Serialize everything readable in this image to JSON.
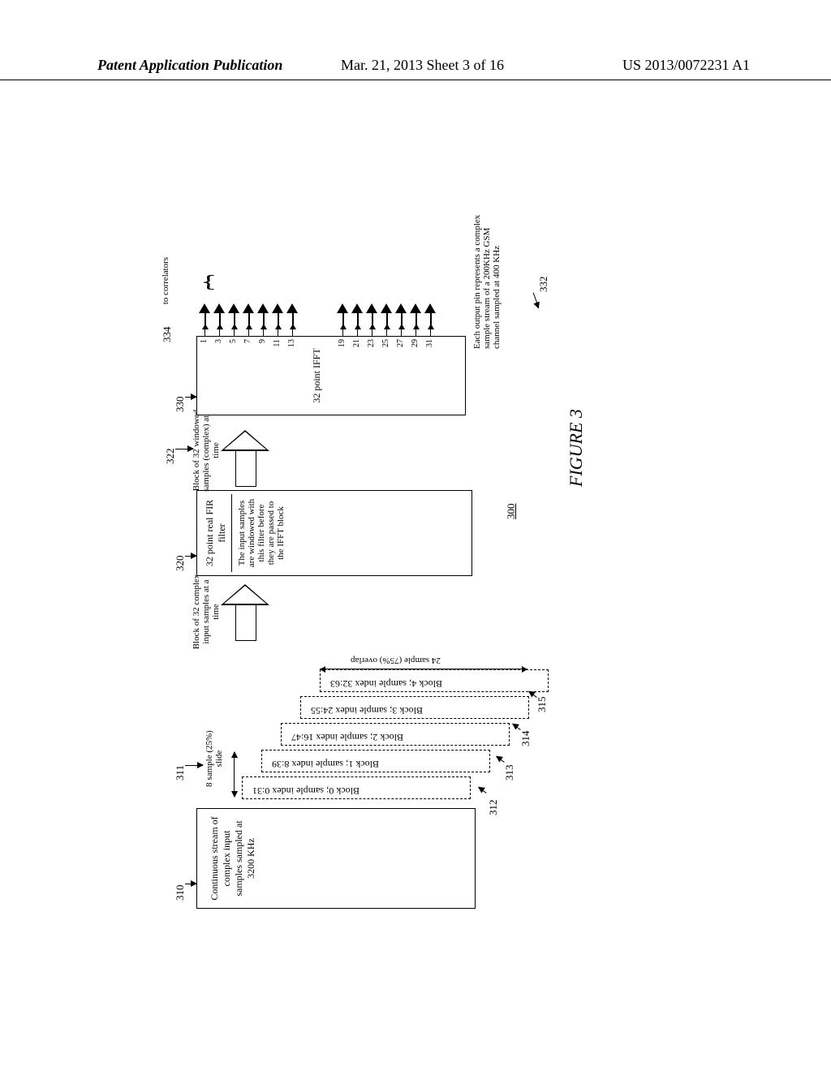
{
  "header": {
    "left": "Patent Application Publication",
    "center": "Mar. 21, 2013  Sheet 3 of 16",
    "right": "US 2013/0072231 A1"
  },
  "input_box": {
    "text": "Continuous stream of complex input samples sampled at 3200 KHz",
    "ref": "310"
  },
  "slide": {
    "text": "8 sample (25%) slide",
    "ref": "311"
  },
  "blocks": {
    "b0": "Block 0; sample index 0:31",
    "b1": "Block 1; sample index 8:39",
    "b2": "Block 2; sample index 16:47",
    "b3": "Block 3; sample index 24:55",
    "b4": "Block 4; sample index 32:63",
    "r0": "312",
    "r1": "313",
    "r2": "314",
    "r3": "315"
  },
  "overlap": "24 sample (75%) overlap",
  "arrow1": {
    "text": "Block of 32 complex input samples at a time"
  },
  "fir": {
    "title": "32 point real FIR filter",
    "desc": "The input samples are windowed with this filter before they are passed to the IFFT block",
    "ref": "320"
  },
  "arrow2": {
    "text": "Block of 32 windowed samples (complex) at a time",
    "ref": "322"
  },
  "ifft": {
    "title": "32 point IFFT",
    "ref": "330",
    "pins": [
      "1",
      "3",
      "5",
      "7",
      "9",
      "11",
      "13",
      "19",
      "21",
      "23",
      "25",
      "27",
      "29",
      "31"
    ],
    "out_ref": "334",
    "out_label": "to correlators",
    "note": "Each output pin represents a complex sample stream of a 200KHz GSM channel sampled at 400 KHz",
    "note_ref": "332"
  },
  "figure": {
    "num": "FIGURE 3",
    "ref": "300"
  }
}
